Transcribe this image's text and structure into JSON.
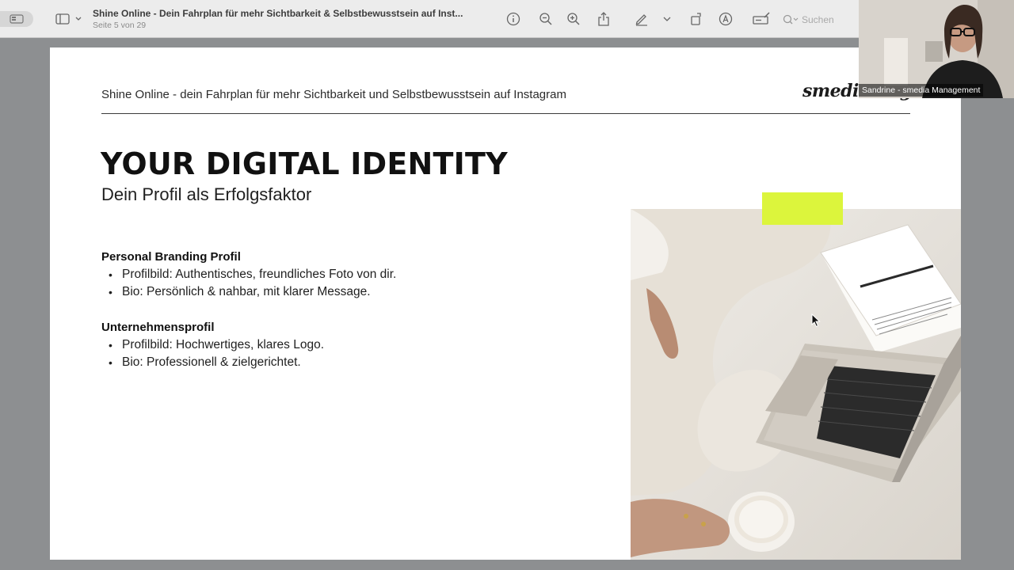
{
  "toolbar": {
    "title": "Shine Online - Dein Fahrplan für mehr Sichtbarkeit & Selbstbewusstsein auf Inst...",
    "subtitle": "Seite 5 von 29",
    "search_placeholder": "Suchen",
    "icons": [
      "sidebar-icon",
      "info-icon",
      "zoom-out-icon",
      "zoom-in-icon",
      "share-icon",
      "markup-pen-icon",
      "rotate-icon",
      "annotate-icon",
      "form-fill-icon",
      "search-icon"
    ]
  },
  "slide": {
    "header": "Shine Online - dein Fahrplan für mehr Sichtbarkeit und Selbstbewusstsein auf Instagram",
    "logo": "smediamngt",
    "heading": "YOUR DIGITAL IDENTITY",
    "subheading": "Dein Profil als Erfolgsfaktor",
    "sections": [
      {
        "title": "Personal Branding Profil",
        "bullets": [
          "Profilbild: Authentisches, freundliches Foto von dir.",
          "Bio: Persönlich & nahbar, mit klarer Message."
        ]
      },
      {
        "title": "Unternehmensprofil",
        "bullets": [
          "Profilbild: Hochwertiges, klares Logo.",
          "Bio: Professionell & zielgerichtet."
        ]
      }
    ],
    "accent_color": "#dcf53c"
  },
  "video": {
    "participant": "Sandrine - smedia Management"
  }
}
